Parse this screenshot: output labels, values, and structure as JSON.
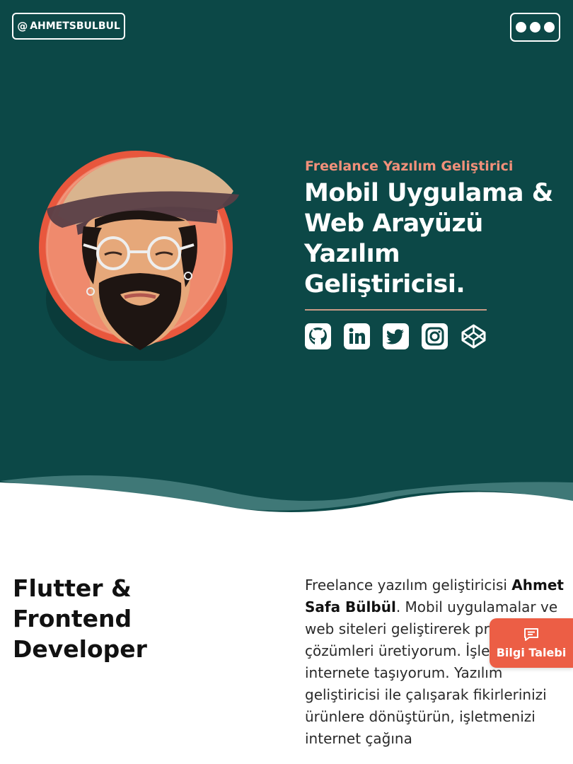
{
  "header": {
    "handle_at": "@",
    "handle_label": "AHMETSBULBUL",
    "menu_icon": "more-dots-icon"
  },
  "hero": {
    "tagline": "Freelance Yazılım Geliştirici",
    "headline_lines": [
      "Mobil Uygulama &",
      "Web Arayüzü",
      "Yazılım",
      "Geliştiricisi."
    ],
    "avatar_icon": "avatar-illustration",
    "socials": [
      {
        "name": "github",
        "icon": "github-icon"
      },
      {
        "name": "linkedin",
        "icon": "linkedin-icon"
      },
      {
        "name": "twitter",
        "icon": "twitter-icon"
      },
      {
        "name": "instagram",
        "icon": "instagram-icon"
      },
      {
        "name": "codepen",
        "icon": "codepen-icon"
      }
    ]
  },
  "about": {
    "title_lines": [
      "Flutter &",
      "Frontend",
      "Developer"
    ],
    "intro_before": "Freelance yazılım geliştiricisi",
    "intro_name": "Ahmet Safa Bülbül",
    "intro_after": ". Mobil uygulamalar ve web siteleri geliştirerek profesyonel çözümleri üretiyorum. İşletmenizi internete taşıyorum. Yazılım geliştiricisi ile çalışarak fikirlerinizi ürünlere dönüştürün, işletmenizi internet çağına"
  },
  "floating": {
    "info_button_label": "Bilgi Talebi",
    "info_button_icon": "message-icon"
  },
  "colors": {
    "hero_bg": "#0c4847",
    "accent": "#ec5e45",
    "tagline": "#f2907a"
  }
}
